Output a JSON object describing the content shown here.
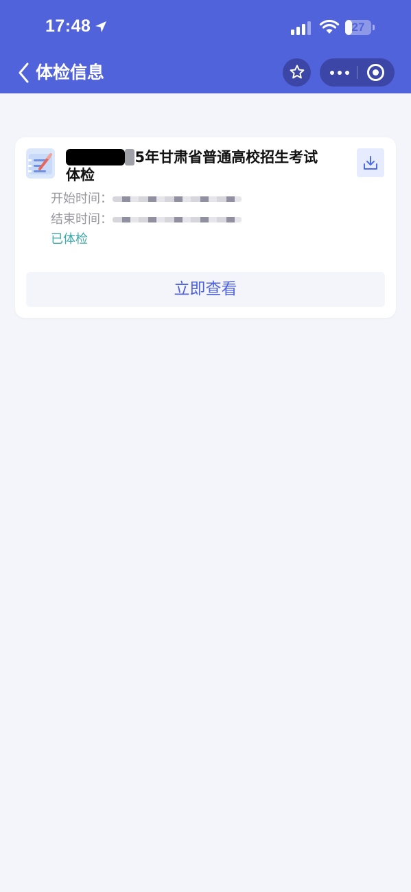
{
  "status_bar": {
    "time": "17:48",
    "battery": "27",
    "battery_level": 0.27,
    "icons": [
      "location-arrow-icon",
      "cellular-signal-icon",
      "wifi-icon",
      "battery-icon"
    ]
  },
  "nav": {
    "title": "体检信息",
    "back_icon": "chevron-left-icon",
    "favorite_icon": "star-icon",
    "more_icon": "ellipsis-icon",
    "close_icon": "target-icon"
  },
  "card": {
    "title_visible": "5年甘肃省普通高校招生考试",
    "title_line2": "体检",
    "start_label": "开始时间：",
    "end_label": "结束时间：",
    "status": "已体检",
    "view_button": "立即查看",
    "download_icon": "download-icon",
    "exam_icon": "exam-form-icon"
  },
  "colors": {
    "primary": "#5063db",
    "capsule": "#3b46a6",
    "background": "#f4f5fa",
    "status_teal": "#3ea8a8"
  }
}
